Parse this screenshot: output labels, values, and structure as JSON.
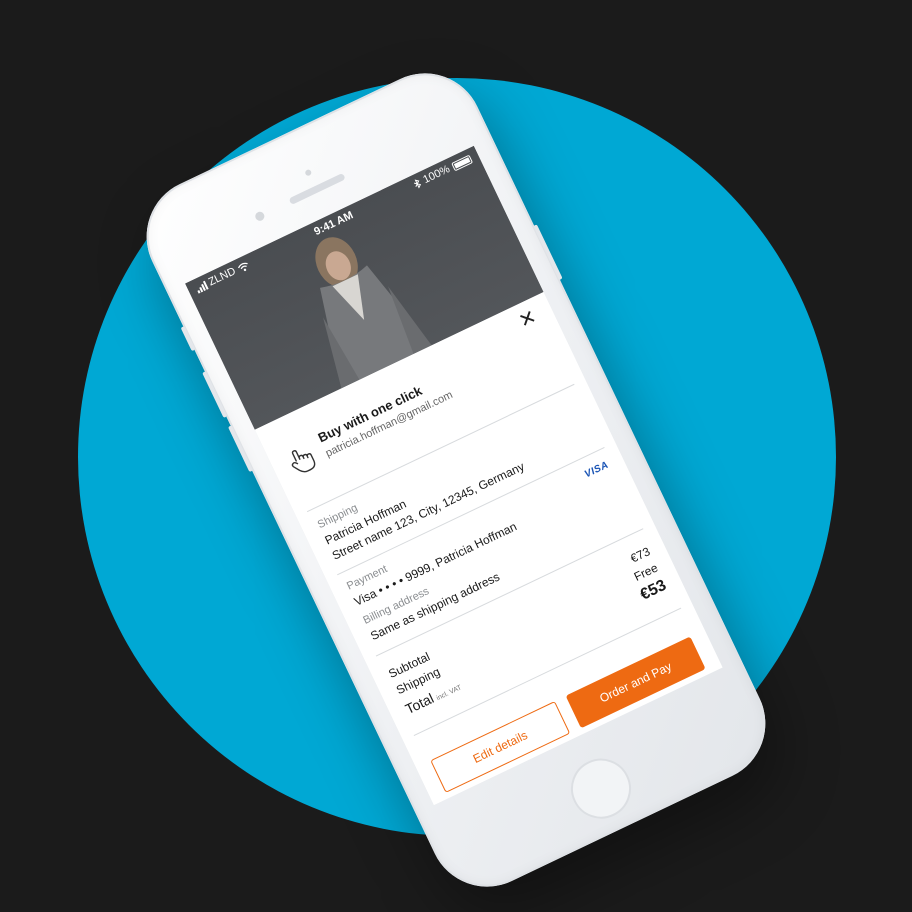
{
  "status_bar": {
    "carrier": "ZLND",
    "time": "9:41 AM",
    "battery": "100%",
    "icons": [
      "signal-icon",
      "wifi-icon",
      "bluetooth-icon",
      "battery-icon"
    ]
  },
  "sheet": {
    "title": "Buy with one click",
    "email": "patricia.hoffman@gmail.com",
    "close_icon": "close-icon",
    "hand_icon": "tap-hand-icon"
  },
  "shipping": {
    "label": "Shipping",
    "name": "Patricia Hoffman",
    "address": "Street name 123, City, 12345, Germany"
  },
  "payment": {
    "label": "Payment",
    "method": "Visa • • • • 9999, Patricia Hoffman",
    "card_brand": "VISA"
  },
  "billing": {
    "label": "Billing address",
    "value": "Same as shipping address"
  },
  "summary": {
    "subtotal_label": "Subtotal",
    "subtotal_value": "€73",
    "shipping_label": "Shipping",
    "shipping_value": "Free",
    "total_label": "Total",
    "total_note": "incl. VAT",
    "total_value": "€53"
  },
  "actions": {
    "edit_label": "Edit details",
    "order_label": "Order and Pay"
  },
  "colors": {
    "background": "#1b1b1b",
    "circle": "#00a8d4",
    "accent": "#ee6a12",
    "visa": "#1a54b5"
  }
}
